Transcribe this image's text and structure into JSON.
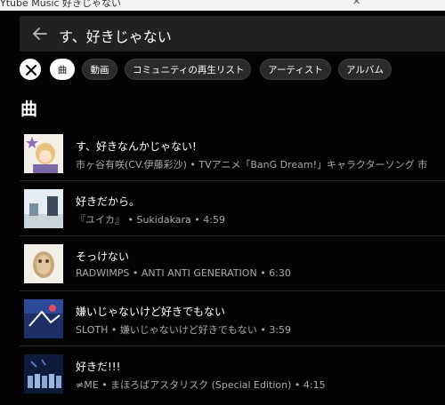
{
  "browser_tab": {
    "text": "Ytube Music 好きじゃない",
    "close": "✕"
  },
  "search": {
    "query": "す、好きじゃない"
  },
  "chips": [
    {
      "label": "曲"
    },
    {
      "label": "動画"
    },
    {
      "label": "コミュニティの再生リスト"
    },
    {
      "label": "アーティスト"
    },
    {
      "label": "アルバム"
    }
  ],
  "section": {
    "title": "曲"
  },
  "songs": [
    {
      "title": "す、好きなんかじゃない!",
      "subtitle": "市ヶ谷有咲(CV.伊藤彩沙) • TVアニメ「BanG Dream!」キャラクターソング 市"
    },
    {
      "title": "好きだから。",
      "subtitle": "『ユイカ』 • Sukidakara • 4:59"
    },
    {
      "title": "そっけない",
      "subtitle": "RADWIMPS • ANTI ANTI GENERATION • 6:30"
    },
    {
      "title": "嫌いじゃないけど好きでもない",
      "subtitle": "SLOTH • 嫌いじゃないけど好きでもない • 3:59"
    },
    {
      "title": "好きだ!!!",
      "subtitle": "≠ME • まほろばアスタリスク (Special Edition) • 4:15"
    }
  ],
  "colors": {
    "background": "#030303",
    "searchbar": "#212121",
    "subtext": "#aaaaaa"
  }
}
